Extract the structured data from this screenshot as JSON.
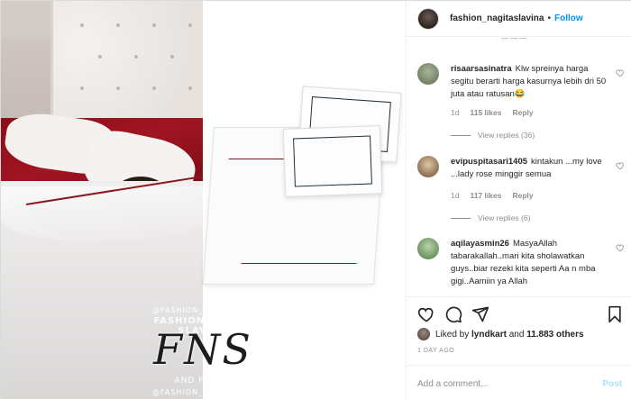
{
  "header": {
    "username": "fashion_nagitaslavina",
    "separator": "•",
    "follow_label": "Follow"
  },
  "media": {
    "watermark": {
      "handle_top": "@FASHION_NAGITASLAVINA",
      "brand_line": "FASHION NAGITA SLAVINA",
      "logo_letters": "FNS",
      "subline": "AND FAMILY",
      "handle_bottom": "@FASHION_NAGITASLAVINA"
    }
  },
  "comments": [
    {
      "username": "risaarsasinatra",
      "text": "Klw spreinya harga segitu berarti harga kasurnya lebih dri 50 juta atau ratusan😂",
      "age": "1d",
      "likes": "115 likes",
      "reply_label": "Reply",
      "view_replies": "View replies (36)",
      "avatar_color": "#7a8d6a"
    },
    {
      "username": "evipuspitasari1405",
      "text": "kintakun ...my love ...lady rose minggir semua",
      "age": "1d",
      "likes": "117 likes",
      "reply_label": "Reply",
      "view_replies": "View replies (6)",
      "avatar_color": "#8a6a4e"
    },
    {
      "username": "aqilayasmin26",
      "text": "MasyaAllah tabarakallah..mari kita sholawatkan guys..biar rezeki kita seperti Aa n mba gigi..Aamiin ya Allah",
      "avatar_color": "#5f8a55"
    }
  ],
  "actions": {
    "icons": [
      "heart-icon",
      "comment-icon",
      "share-icon",
      "bookmark-icon"
    ]
  },
  "likes": {
    "prefix": "Liked by",
    "user": "lyndkart",
    "joiner": "and",
    "others": "11.883 others"
  },
  "timestamp": "1 DAY AGO",
  "add_comment": {
    "placeholder": "Add a comment...",
    "post_label": "Post"
  },
  "colors": {
    "link_blue": "#0095f6",
    "muted": "#8e8e8e",
    "post_disabled": "#b2dffc"
  }
}
